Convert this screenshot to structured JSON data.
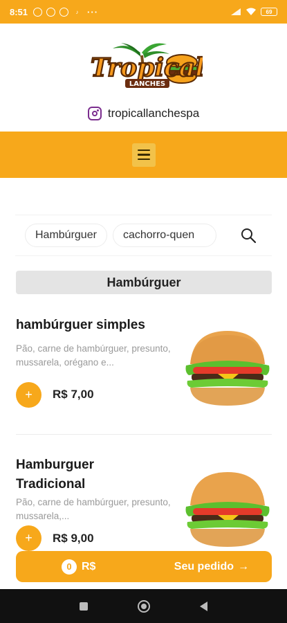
{
  "status_bar": {
    "time": "8:51",
    "dots": "···",
    "battery": "69"
  },
  "brand": {
    "name": "Tropical",
    "sub": "LANCHES",
    "instagram_handle": "tropicallanchespa"
  },
  "categories": [
    "Hambúrguer",
    "cachorro-quen"
  ],
  "section": {
    "title": "Hambúrguer"
  },
  "products": [
    {
      "name": "hambúrguer simples",
      "description": "Pão, carne de hambúrguer, presunto, mussarela, orégano e...",
      "price": "R$ 7,00",
      "add": "+"
    },
    {
      "name": "Hamburguer Tradicional",
      "description": "Pão, carne de hambúrguer, presunto, mussarela,...",
      "price": "R$ 9,00",
      "add": "+"
    }
  ],
  "order_bar": {
    "count": "0",
    "currency": "R$",
    "label": "Seu pedido",
    "arrow": "→"
  },
  "colors": {
    "accent": "#f7a81b",
    "nav_bar": "#111111"
  },
  "icons": {
    "menu": "hamburger-menu-icon",
    "search": "search-icon",
    "instagram": "instagram-icon"
  }
}
